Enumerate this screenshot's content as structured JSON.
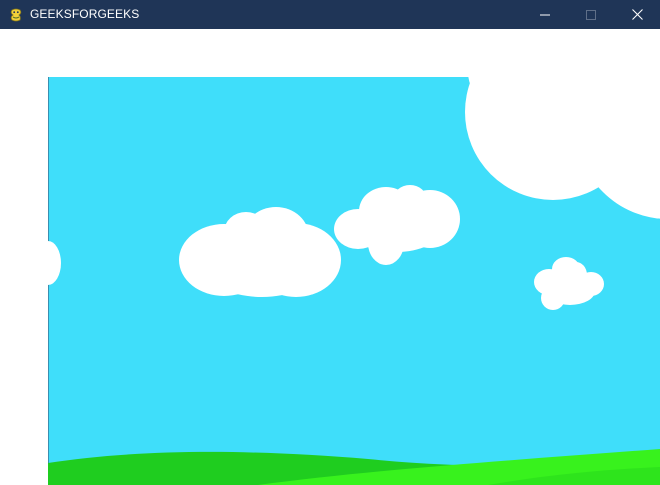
{
  "window": {
    "title": "GEEKSFORGEEKS",
    "icon": "pygame-snake-icon",
    "controls": [
      "minimize-icon",
      "maximize-icon",
      "close-icon"
    ]
  },
  "scene": {
    "sky_color": "#3fdefa",
    "cloud_color": "#ffffff",
    "ground_dark_color": "#1fcd1f",
    "ground_light_color": "#38f21d",
    "border_color": "#3a8fb0"
  }
}
